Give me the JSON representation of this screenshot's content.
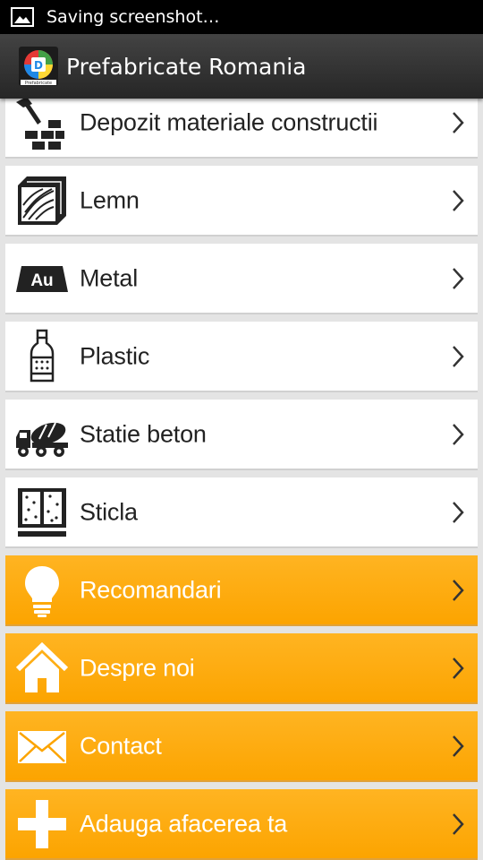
{
  "status_bar": {
    "text": "Saving screenshot…",
    "icon": "picture-icon"
  },
  "action_bar": {
    "title": "Prefabricate Romania",
    "logo_text": "Prefabricate",
    "logo_icon": "app-logo-icon"
  },
  "colors": {
    "accent_orange": "#fca400",
    "row_white": "#ffffff",
    "action_bar": "#333333"
  },
  "menu": {
    "items": [
      {
        "label": "Depozit materiale constructii",
        "icon": "hammer-bricks-icon"
      },
      {
        "label": "Lemn",
        "icon": "wood-icon"
      },
      {
        "label": "Metal",
        "icon": "gold-bar-icon",
        "icon_text": "Au"
      },
      {
        "label": "Plastic",
        "icon": "plastic-bottle-icon"
      },
      {
        "label": "Statie beton",
        "icon": "concrete-mixer-truck-icon"
      },
      {
        "label": "Sticla",
        "icon": "glass-window-icon"
      },
      {
        "label": "Recomandari",
        "icon": "lightbulb-icon"
      },
      {
        "label": "Despre noi",
        "icon": "home-icon"
      },
      {
        "label": "Contact",
        "icon": "envelope-icon"
      },
      {
        "label": "Adauga afacerea ta",
        "icon": "plus-icon"
      }
    ]
  }
}
